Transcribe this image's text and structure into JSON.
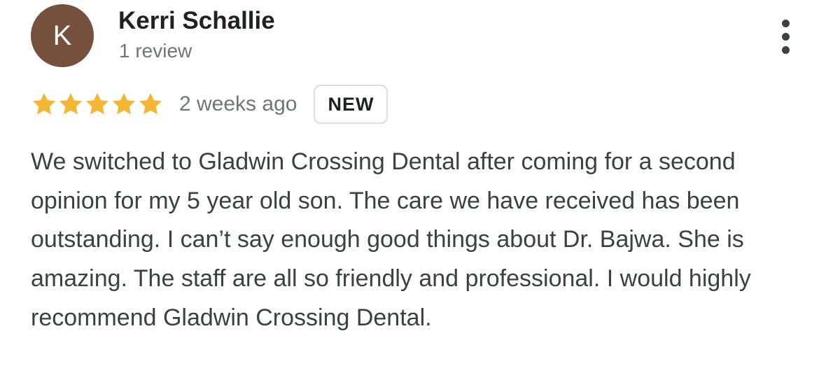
{
  "review": {
    "author": {
      "avatar_initial": "K",
      "avatar_color": "#74503d",
      "name": "Kerri Schallie",
      "meta": "1 review"
    },
    "rating": {
      "stars": 5,
      "max_stars": 5,
      "star_color": "#f4b633"
    },
    "time": "2 weeks ago",
    "badge": "NEW",
    "menu_icon": "more-vertical-icon",
    "text": "We switched to Gladwin Crossing Dental after coming for a second opinion for my 5 year old son. The care we have received has been outstanding. I can’t say enough good things about Dr. Bajwa. She is amazing. The staff are all so friendly and professional. I would highly recommend Gladwin Crossing Dental."
  }
}
